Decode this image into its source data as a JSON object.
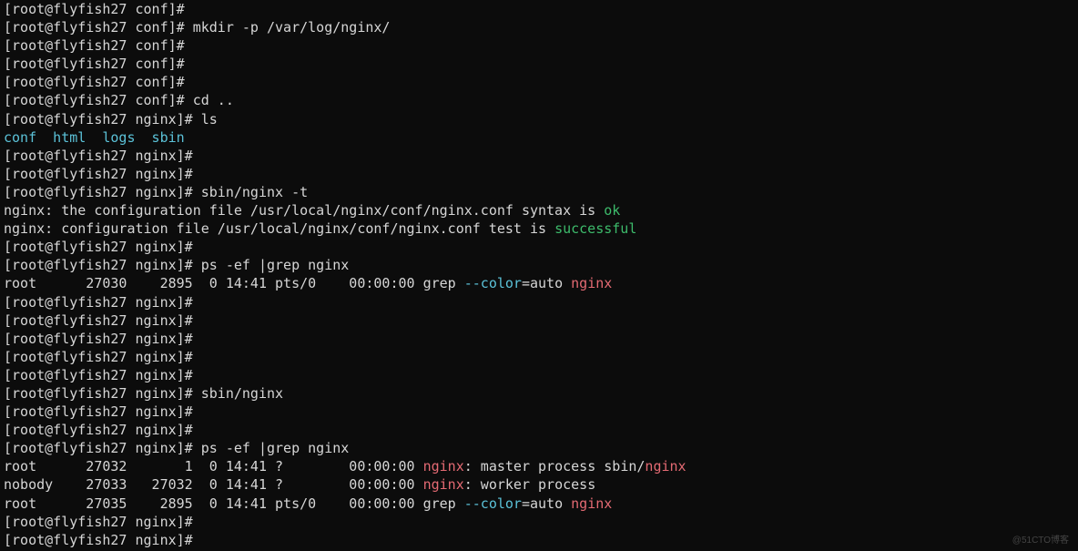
{
  "host": "flyfish27",
  "user": "root",
  "colors": {
    "fg": "#d6d6d6",
    "cyan": "#5bc2d8",
    "green": "#3dbb6b",
    "red": "#e46a73",
    "bg": "#0c0c0c"
  },
  "watermark": "@51CTO博客",
  "lines": [
    {
      "t": "prompt",
      "dir": "conf",
      "cmd": ""
    },
    {
      "t": "prompt",
      "dir": "conf",
      "cmd": "mkdir -p /var/log/nginx/"
    },
    {
      "t": "prompt",
      "dir": "conf",
      "cmd": ""
    },
    {
      "t": "prompt",
      "dir": "conf",
      "cmd": ""
    },
    {
      "t": "prompt",
      "dir": "conf",
      "cmd": ""
    },
    {
      "t": "prompt",
      "dir": "conf",
      "cmd": "cd .."
    },
    {
      "t": "prompt",
      "dir": "nginx",
      "cmd": "ls"
    },
    {
      "t": "ls",
      "items": [
        "conf",
        "html",
        "logs",
        "sbin"
      ]
    },
    {
      "t": "prompt",
      "dir": "nginx",
      "cmd": ""
    },
    {
      "t": "prompt",
      "dir": "nginx",
      "cmd": ""
    },
    {
      "t": "prompt",
      "dir": "nginx",
      "cmd": "sbin/nginx -t"
    },
    {
      "t": "nginx-test",
      "pre": "nginx: the configuration file /usr/local/nginx/conf/nginx.conf syntax is ",
      "status": "ok"
    },
    {
      "t": "nginx-test",
      "pre": "nginx: configuration file /usr/local/nginx/conf/nginx.conf test is ",
      "status": "successful"
    },
    {
      "t": "prompt",
      "dir": "nginx",
      "cmd": ""
    },
    {
      "t": "prompt",
      "dir": "nginx",
      "cmd": "ps -ef |grep nginx"
    },
    {
      "t": "ps-grep",
      "user": "root",
      "pid": "27030",
      "ppid": "2895",
      "c": "0",
      "stime": "14:41",
      "tty": "pts/0",
      "time": "00:00:00",
      "kw": "nginx"
    },
    {
      "t": "prompt",
      "dir": "nginx",
      "cmd": ""
    },
    {
      "t": "prompt",
      "dir": "nginx",
      "cmd": ""
    },
    {
      "t": "prompt",
      "dir": "nginx",
      "cmd": ""
    },
    {
      "t": "prompt",
      "dir": "nginx",
      "cmd": ""
    },
    {
      "t": "prompt",
      "dir": "nginx",
      "cmd": ""
    },
    {
      "t": "prompt",
      "dir": "nginx",
      "cmd": "sbin/nginx"
    },
    {
      "t": "prompt",
      "dir": "nginx",
      "cmd": ""
    },
    {
      "t": "prompt",
      "dir": "nginx",
      "cmd": ""
    },
    {
      "t": "prompt",
      "dir": "nginx",
      "cmd": "ps -ef |grep nginx"
    },
    {
      "t": "ps-nginx",
      "user": "root",
      "pid": "27032",
      "ppid": "1",
      "c": "0",
      "stime": "14:41",
      "tty": "?",
      "time": "00:00:00",
      "tail1": ": master process sbin/",
      "tail2": "nginx"
    },
    {
      "t": "ps-nginx",
      "user": "nobody",
      "pid": "27033",
      "ppid": "27032",
      "c": "0",
      "stime": "14:41",
      "tty": "?",
      "time": "00:00:00",
      "tail1": ": worker process",
      "tail2": ""
    },
    {
      "t": "ps-grep",
      "user": "root",
      "pid": "27035",
      "ppid": "2895",
      "c": "0",
      "stime": "14:41",
      "tty": "pts/0",
      "time": "00:00:00",
      "kw": "nginx"
    },
    {
      "t": "prompt",
      "dir": "nginx",
      "cmd": ""
    },
    {
      "t": "prompt",
      "dir": "nginx",
      "cmd": ""
    }
  ]
}
